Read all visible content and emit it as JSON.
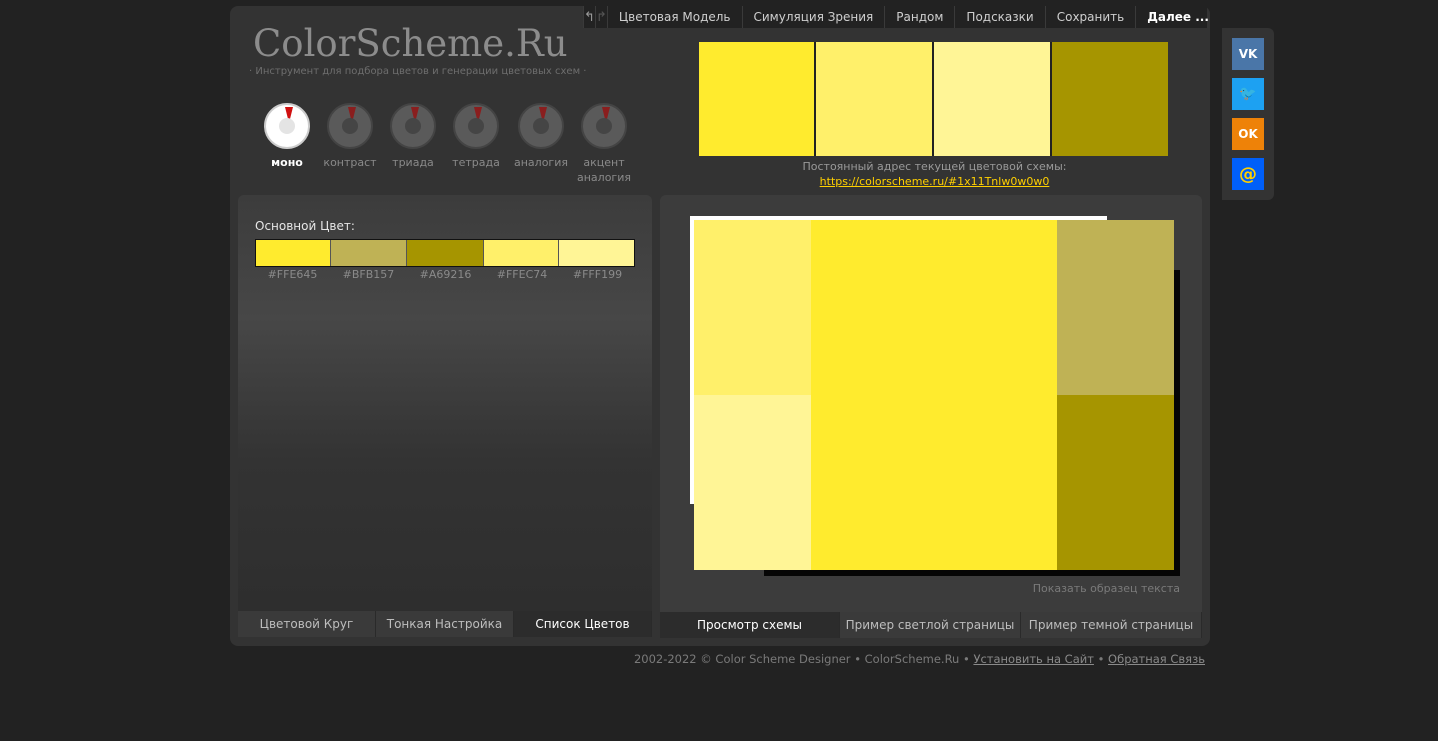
{
  "nav": {
    "undo_icon": "undo-icon",
    "redo_icon": "redo-icon",
    "items": [
      "Цветовая Модель",
      "Симуляция Зрения",
      "Рандом",
      "Подсказки",
      "Сохранить",
      "Далее ..."
    ]
  },
  "header": {
    "logo": "ColorScheme.Ru",
    "tagline": "· Инструмент для подбора цветов и генерации цветовых схем ·"
  },
  "modes": [
    {
      "label": "моно",
      "active": true
    },
    {
      "label": "контраст",
      "active": false
    },
    {
      "label": "триада",
      "active": false
    },
    {
      "label": "тетрада",
      "active": false
    },
    {
      "label": "аналогия",
      "active": false
    },
    {
      "label": "акцент аналогия",
      "active": false
    }
  ],
  "preview": {
    "swatches": [
      "#FFEB2E",
      "#FFF06A",
      "#FFF596",
      "#A69500"
    ],
    "permalink_label": "Постоянный адрес текущей цветовой схемы:",
    "permalink": "https://colorscheme.ru/#1x11Tnlw0w0w0"
  },
  "left_panel": {
    "base_label": "Основной Цвет:",
    "colors": [
      {
        "hex": "#FFE645",
        "swatch": "#FFEB2E"
      },
      {
        "hex": "#BFB157",
        "swatch": "#BFB255"
      },
      {
        "hex": "#A69216",
        "swatch": "#A69500"
      },
      {
        "hex": "#FFEC74",
        "swatch": "#FFF06A"
      },
      {
        "hex": "#FFF199",
        "swatch": "#FFF596"
      }
    ],
    "tabs": [
      {
        "label": "Цветовой Круг",
        "active": false
      },
      {
        "label": "Тонкая Настройка",
        "active": false
      },
      {
        "label": "Список Цветов",
        "active": true
      }
    ]
  },
  "right_panel": {
    "mock_colors": {
      "main": "#FFEB2E",
      "top_left": "#FFF06A",
      "bottom_left": "#FFF596",
      "top_right": "#BFB255",
      "bottom_right": "#A69500"
    },
    "sample_text_link": "Показать образец текста",
    "tabs": [
      {
        "label": "Просмотр схемы",
        "active": true
      },
      {
        "label": "Пример светлой страницы",
        "active": false
      },
      {
        "label": "Пример темной страницы",
        "active": false
      }
    ]
  },
  "footer": {
    "copyright": "2002-2022 © Color Scheme Designer • ColorScheme.Ru •",
    "install_link": "Установить на Сайт",
    "separator": "•",
    "feedback_link": "Обратная Связь"
  },
  "social": [
    {
      "name": "vk",
      "glyph": "VK",
      "color": "#4A76A8"
    },
    {
      "name": "twitter",
      "glyph": "🐦",
      "color": "#1DA1F2"
    },
    {
      "name": "odnoklassniki",
      "glyph": "OK",
      "color": "#EE8208"
    },
    {
      "name": "mailru",
      "glyph": "@",
      "color": "#005FF9"
    }
  ]
}
